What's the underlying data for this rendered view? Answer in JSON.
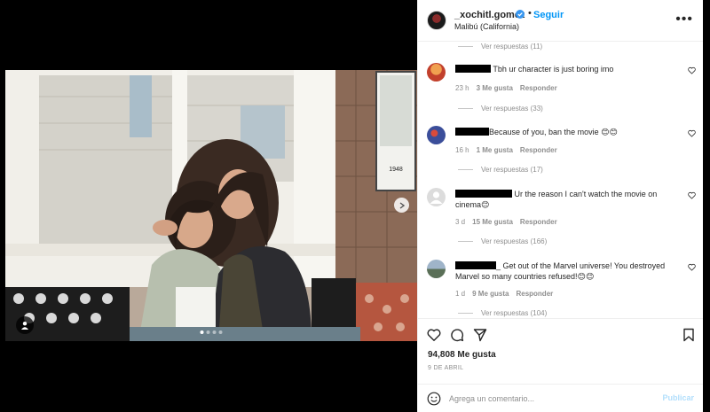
{
  "post": {
    "username": "_xochitl.gomez",
    "follow_label": "Seguir",
    "separator": "•",
    "location": "Malibú (California)",
    "more_label": "•••"
  },
  "photo": {
    "sign_text": "1948"
  },
  "comments": {
    "replies": [
      {
        "label": "Ver respuestas (11)"
      },
      {
        "label": "Ver respuestas (33)"
      },
      {
        "label": "Ver respuestas (17)"
      },
      {
        "label": "Ver respuestas (166)"
      },
      {
        "label": "Ver respuestas (104)"
      }
    ],
    "items": [
      {
        "text": "Tbh ur character is just boring imo",
        "time": "23 h",
        "likes": "3 Me gusta",
        "reply": "Responder",
        "avatar_color": "#d9623b"
      },
      {
        "text": "Because of you, ban the movie 😊😊",
        "time": "16 h",
        "likes": "1 Me gusta",
        "reply": "Responder",
        "avatar_color": "#5b6fb5"
      },
      {
        "text": "Ur the reason I can't watch the movie on cinema😊",
        "time": "3 d",
        "likes": "15 Me gusta",
        "reply": "Responder",
        "avatar_color": "#dcdcdc"
      },
      {
        "text": "_ Get out of the Marvel universe! You destroyed Marvel so many countries refused!😊😊",
        "time": "1 d",
        "likes": "9 Me gusta",
        "reply": "Responder",
        "avatar_color": "#7d93a8"
      }
    ]
  },
  "actions": {
    "likes_count": "94,808 Me gusta",
    "date": "9 DE ABRIL"
  },
  "composer": {
    "placeholder": "Agrega un comentario...",
    "publish_label": "Publicar"
  },
  "colors": {
    "accent": "#0095f6",
    "muted_text": "#8e8e8e",
    "publish_disabled": "#b2dffc"
  }
}
